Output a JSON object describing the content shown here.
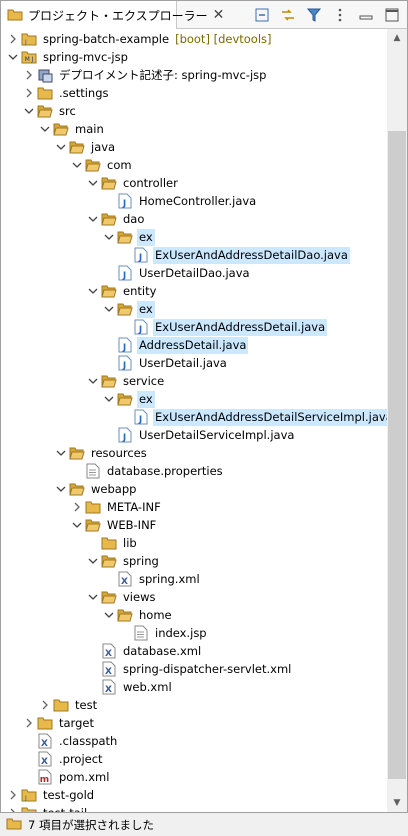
{
  "view": {
    "title": "プロジェクト・エクスプローラー",
    "close_glyph": "✕",
    "toolbar_icons": [
      "collapse-all-icon",
      "link-with-editor-icon",
      "filter-icon",
      "view-menu-icon",
      "minimize-icon",
      "maximize-icon"
    ]
  },
  "tree": {
    "items": [
      {
        "label": "spring-batch-example",
        "deco": "[boot] [devtools]",
        "icon": "project-icon",
        "depth": 0,
        "expanded": false,
        "twisty": true,
        "selected": false
      },
      {
        "label": "spring-mvc-jsp",
        "icon": "maven-project-icon",
        "depth": 0,
        "expanded": true,
        "twisty": true,
        "selected": false
      },
      {
        "label": "デプロイメント記述子: spring-mvc-jsp",
        "icon": "deployment-descriptor-icon",
        "depth": 1,
        "expanded": false,
        "twisty": true,
        "selected": false
      },
      {
        "label": ".settings",
        "icon": "folder-icon",
        "depth": 1,
        "expanded": false,
        "twisty": true,
        "selected": false
      },
      {
        "label": "src",
        "icon": "folder-open-icon",
        "depth": 1,
        "expanded": true,
        "twisty": true,
        "selected": false
      },
      {
        "label": "main",
        "icon": "folder-open-icon",
        "depth": 2,
        "expanded": true,
        "twisty": true,
        "selected": false
      },
      {
        "label": "java",
        "icon": "folder-open-icon",
        "depth": 3,
        "expanded": true,
        "twisty": true,
        "selected": false
      },
      {
        "label": "com",
        "icon": "folder-open-icon",
        "depth": 4,
        "expanded": true,
        "twisty": true,
        "selected": false
      },
      {
        "label": "controller",
        "icon": "folder-open-icon",
        "depth": 5,
        "expanded": true,
        "twisty": true,
        "selected": false
      },
      {
        "label": "HomeController.java",
        "icon": "java-file-icon",
        "depth": 6,
        "expanded": false,
        "twisty": false,
        "selected": false
      },
      {
        "label": "dao",
        "icon": "folder-open-icon",
        "depth": 5,
        "expanded": true,
        "twisty": true,
        "selected": false
      },
      {
        "label": "ex",
        "icon": "folder-open-icon",
        "depth": 6,
        "expanded": true,
        "twisty": true,
        "selected": true
      },
      {
        "label": "ExUserAndAddressDetailDao.java",
        "icon": "java-file-icon",
        "depth": 7,
        "expanded": false,
        "twisty": false,
        "selected": true
      },
      {
        "label": "UserDetailDao.java",
        "icon": "java-file-icon",
        "depth": 6,
        "expanded": false,
        "twisty": false,
        "selected": false
      },
      {
        "label": "entity",
        "icon": "folder-open-icon",
        "depth": 5,
        "expanded": true,
        "twisty": true,
        "selected": false
      },
      {
        "label": "ex",
        "icon": "folder-open-icon",
        "depth": 6,
        "expanded": true,
        "twisty": true,
        "selected": true
      },
      {
        "label": "ExUserAndAddressDetail.java",
        "icon": "java-file-icon",
        "depth": 7,
        "expanded": false,
        "twisty": false,
        "selected": true
      },
      {
        "label": "AddressDetail.java",
        "icon": "java-file-icon",
        "depth": 6,
        "expanded": false,
        "twisty": false,
        "selected": true
      },
      {
        "label": "UserDetail.java",
        "icon": "java-file-icon",
        "depth": 6,
        "expanded": false,
        "twisty": false,
        "selected": false
      },
      {
        "label": "service",
        "icon": "folder-open-icon",
        "depth": 5,
        "expanded": true,
        "twisty": true,
        "selected": false
      },
      {
        "label": "ex",
        "icon": "folder-open-icon",
        "depth": 6,
        "expanded": true,
        "twisty": true,
        "selected": true
      },
      {
        "label": "ExUserAndAddressDetailServiceImpl.java",
        "icon": "java-file-icon",
        "depth": 7,
        "expanded": false,
        "twisty": false,
        "selected": true
      },
      {
        "label": "UserDetailServiceImpl.java",
        "icon": "java-file-icon",
        "depth": 6,
        "expanded": false,
        "twisty": false,
        "selected": false
      },
      {
        "label": "resources",
        "icon": "folder-open-icon",
        "depth": 3,
        "expanded": true,
        "twisty": true,
        "selected": false
      },
      {
        "label": "database.properties",
        "icon": "text-file-icon",
        "depth": 4,
        "expanded": false,
        "twisty": false,
        "selected": false
      },
      {
        "label": "webapp",
        "icon": "folder-open-icon",
        "depth": 3,
        "expanded": true,
        "twisty": true,
        "selected": false
      },
      {
        "label": "META-INF",
        "icon": "folder-icon",
        "depth": 4,
        "expanded": false,
        "twisty": true,
        "selected": false
      },
      {
        "label": "WEB-INF",
        "icon": "folder-open-icon",
        "depth": 4,
        "expanded": true,
        "twisty": true,
        "selected": false
      },
      {
        "label": "lib",
        "icon": "folder-icon",
        "depth": 5,
        "expanded": false,
        "twisty": false,
        "selected": false
      },
      {
        "label": "spring",
        "icon": "folder-open-icon",
        "depth": 5,
        "expanded": true,
        "twisty": true,
        "selected": false
      },
      {
        "label": "spring.xml",
        "icon": "xml-file-icon",
        "depth": 6,
        "expanded": false,
        "twisty": false,
        "selected": false
      },
      {
        "label": "views",
        "icon": "folder-open-icon",
        "depth": 5,
        "expanded": true,
        "twisty": true,
        "selected": false
      },
      {
        "label": "home",
        "icon": "folder-open-icon",
        "depth": 6,
        "expanded": true,
        "twisty": true,
        "selected": false
      },
      {
        "label": "index.jsp",
        "icon": "text-file-icon",
        "depth": 7,
        "expanded": false,
        "twisty": false,
        "selected": false
      },
      {
        "label": "database.xml",
        "icon": "xml-file-icon",
        "depth": 5,
        "expanded": false,
        "twisty": false,
        "selected": false
      },
      {
        "label": "spring-dispatcher-servlet.xml",
        "icon": "xml-file-icon",
        "depth": 5,
        "expanded": false,
        "twisty": false,
        "selected": false
      },
      {
        "label": "web.xml",
        "icon": "xml-file-icon",
        "depth": 5,
        "expanded": false,
        "twisty": false,
        "selected": false
      },
      {
        "label": "test",
        "icon": "folder-icon",
        "depth": 2,
        "expanded": false,
        "twisty": true,
        "selected": false
      },
      {
        "label": "target",
        "icon": "folder-icon",
        "depth": 1,
        "expanded": false,
        "twisty": true,
        "selected": false
      },
      {
        "label": ".classpath",
        "icon": "xml-file-icon",
        "depth": 1,
        "expanded": false,
        "twisty": false,
        "selected": false
      },
      {
        "label": ".project",
        "icon": "xml-file-icon",
        "depth": 1,
        "expanded": false,
        "twisty": false,
        "selected": false
      },
      {
        "label": "pom.xml",
        "icon": "maven-pom-icon",
        "depth": 1,
        "expanded": false,
        "twisty": false,
        "selected": false
      },
      {
        "label": "test-gold",
        "icon": "project-icon",
        "depth": 0,
        "expanded": false,
        "twisty": true,
        "selected": false
      },
      {
        "label": "test-tail",
        "icon": "project-icon",
        "depth": 0,
        "expanded": false,
        "twisty": true,
        "selected": false
      }
    ]
  },
  "status": {
    "text": "7 項目が選択されました",
    "icon": "folder-icon"
  },
  "colors": {
    "selection": "#cce8ff",
    "folder": "#e8b84a",
    "java": "#2a6ab8",
    "decoration": "#7a6a00"
  }
}
